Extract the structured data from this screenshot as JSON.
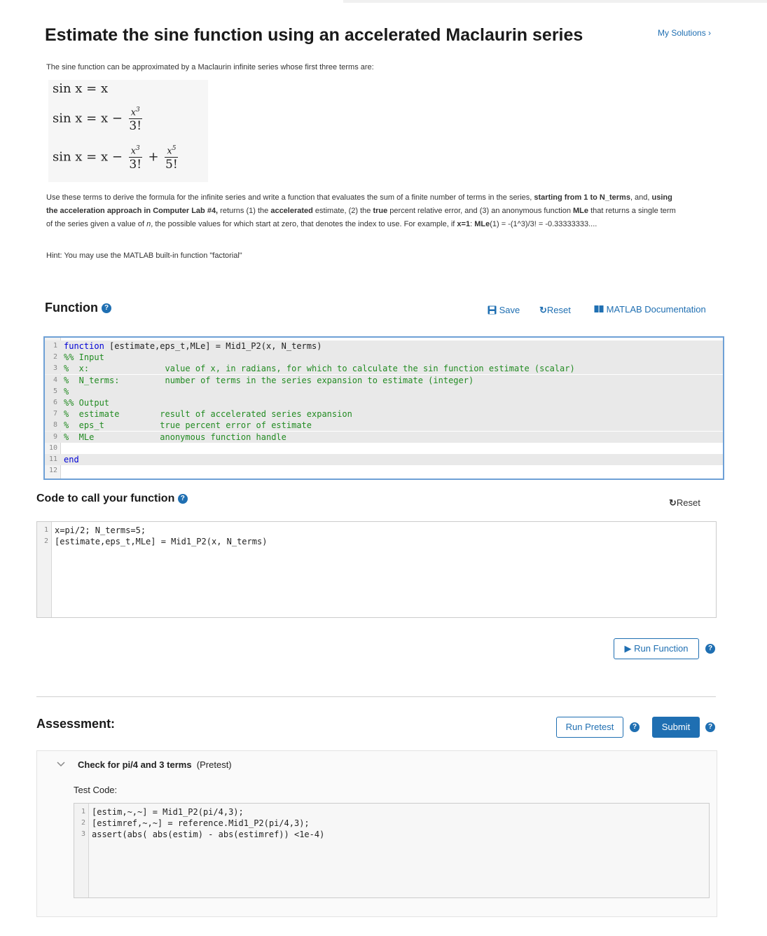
{
  "page": {
    "title": "Estimate the sine function using an accelerated Maclaurin series",
    "my_solutions": "My Solutions ›"
  },
  "description": {
    "intro": "The sine function can be approximated by a Maclaurin infinite series whose first three terms are:",
    "body_parts": [
      {
        "t": "Use these terms to derive the formula for the infinite series and write a function that evaluates the sum of a finite number of terms in the series, ",
        "b": false
      },
      {
        "t": "starting from 1 to N_terms",
        "b": true
      },
      {
        "t": ", and, ",
        "b": false
      },
      {
        "t": "using the acceleration approach in Computer Lab #4,",
        "b": true
      },
      {
        "t": " returns (1) the ",
        "b": false
      },
      {
        "t": "accelerated",
        "b": true
      },
      {
        "t": " estimate, (2) the ",
        "b": false
      },
      {
        "t": "true",
        "b": true
      },
      {
        "t": " percent relative error, and (3) an anonymous function ",
        "b": false
      },
      {
        "t": "MLe",
        "b": true
      },
      {
        "t": " that returns a single term of the series given a value of ",
        "b": false
      },
      {
        "t": "n",
        "b": false,
        "i": true
      },
      {
        "t": ", the possible values for which start at zero, that denotes the index to use. For example, if ",
        "b": false
      },
      {
        "t": "x=1",
        "b": true
      },
      {
        "t": ":  ",
        "b": false
      },
      {
        "t": "MLe",
        "b": true
      },
      {
        "t": "(1) = -(1^3)/3! = -0.33333333....",
        "b": false
      }
    ],
    "hint": "Hint: You may use the MATLAB built-in function \"factorial\""
  },
  "math": {
    "lhs": "sin x = x",
    "minus": "−",
    "plus": "+",
    "term_x3_num": "x",
    "term_x3_exp": "3",
    "term_x3_den": "3!",
    "term_x5_num": "x",
    "term_x5_exp": "5",
    "term_x5_den": "5!"
  },
  "function_section": {
    "title": "Function",
    "save_label": "Save",
    "reset_label": "Reset",
    "docs_label": "MATLAB Documentation",
    "code_lines": [
      {
        "n": "1",
        "segs": [
          {
            "c": "kw",
            "t": "function"
          },
          {
            "c": "",
            "t": " [estimate,eps_t,MLe] = Mid1_P2(x, N_terms)"
          }
        ]
      },
      {
        "n": "2",
        "segs": [
          {
            "c": "cm",
            "t": "%% Input"
          }
        ]
      },
      {
        "n": "3",
        "segs": [
          {
            "c": "cm",
            "t": "%  x:               value of x, in radians, for which to calculate the sin function estimate (scalar)"
          }
        ]
      },
      {
        "n": "4",
        "segs": [
          {
            "c": "cm",
            "t": "%  N_terms:         number of terms in the series expansion to estimate (integer)"
          }
        ]
      },
      {
        "n": "5",
        "segs": [
          {
            "c": "cm",
            "t": "%"
          }
        ]
      },
      {
        "n": "6",
        "segs": [
          {
            "c": "cm",
            "t": "%% Output"
          }
        ]
      },
      {
        "n": "7",
        "segs": [
          {
            "c": "cm",
            "t": "%  estimate        result of accelerated series expansion"
          }
        ]
      },
      {
        "n": "8",
        "segs": [
          {
            "c": "cm",
            "t": "%  eps_t           true percent error of estimate"
          }
        ]
      },
      {
        "n": "9",
        "segs": [
          {
            "c": "cm",
            "t": "%  MLe             anonymous function handle"
          }
        ]
      },
      {
        "n": "10",
        "segs": [
          {
            "c": "",
            "t": ""
          }
        ]
      },
      {
        "n": "11",
        "segs": [
          {
            "c": "kw",
            "t": "end"
          }
        ]
      },
      {
        "n": "12",
        "segs": [
          {
            "c": "",
            "t": ""
          }
        ]
      }
    ]
  },
  "call_section": {
    "title": "Code to call your function",
    "reset_label": "Reset",
    "code_lines": [
      {
        "n": "1",
        "t": "x=pi/2; N_terms=5;"
      },
      {
        "n": "2",
        "t": "[estimate,eps_t,MLe] = Mid1_P2(x, N_terms)"
      }
    ],
    "run_label": "▶ Run Function"
  },
  "assessment": {
    "title": "Assessment:",
    "run_pretest_label": "Run Pretest",
    "submit_label": "Submit",
    "test_name": "Check for pi/4 and 3 terms",
    "test_tag": "(Pretest)",
    "test_code_label": "Test Code:",
    "code_lines": [
      {
        "n": "1",
        "t": "[estim,~,~] = Mid1_P2(pi/4,3);"
      },
      {
        "n": "2",
        "t": "[estimref,~,~] = reference.Mid1_P2(pi/4,3);"
      },
      {
        "n": "3",
        "t": "assert(abs( abs(estim) - abs(estimref)) <1e-4)"
      }
    ]
  },
  "help_glyph": "?",
  "colors": {
    "accent": "#1f6fb2",
    "keyword": "#0000d6",
    "comment": "#228b22"
  }
}
